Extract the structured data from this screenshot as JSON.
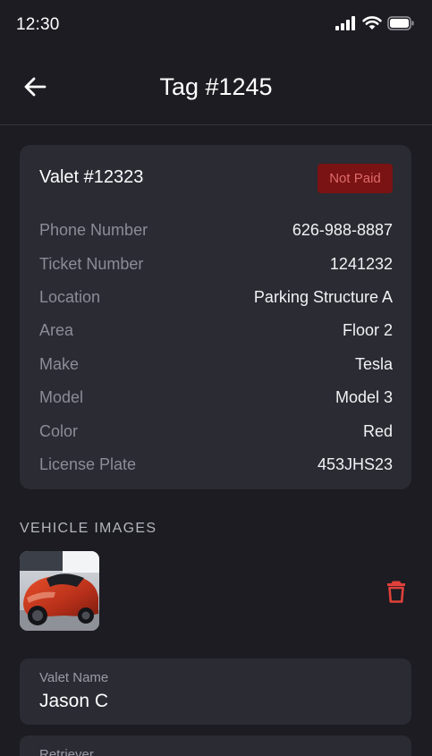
{
  "status_bar": {
    "time": "12:30"
  },
  "nav": {
    "title": "Tag #1245"
  },
  "card": {
    "title": "Valet #12323",
    "badge": "Not Paid",
    "rows": [
      {
        "label": "Phone Number",
        "value": "626-988-8887"
      },
      {
        "label": "Ticket Number",
        "value": "1241232"
      },
      {
        "label": "Location",
        "value": "Parking Structure A"
      },
      {
        "label": "Area",
        "value": "Floor 2"
      },
      {
        "label": "Make",
        "value": "Tesla"
      },
      {
        "label": "Model",
        "value": "Model 3"
      },
      {
        "label": "Color",
        "value": "Red"
      },
      {
        "label": "License Plate",
        "value": "453JHS23"
      }
    ]
  },
  "images": {
    "heading": "VEHICLE IMAGES"
  },
  "fields": {
    "valet_name": {
      "label": "Valet Name",
      "value": "Jason C"
    },
    "retriever": {
      "label": "Retriever"
    }
  },
  "colors": {
    "background": "#1c1c22",
    "card": "#2a2b33",
    "badge_bg": "#7a1313",
    "badge_text": "#e06a6a",
    "delete": "#e0403a"
  },
  "icons": [
    "cellular-signal-icon",
    "wifi-icon",
    "battery-icon",
    "back-arrow-icon",
    "trash-icon"
  ]
}
